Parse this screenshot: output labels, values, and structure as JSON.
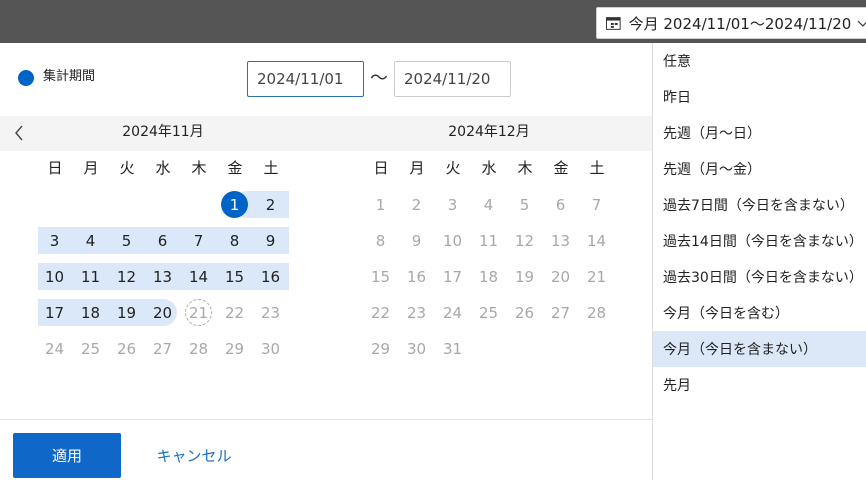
{
  "header": {
    "range_label": "今月 2024/11/01〜2024/11/20"
  },
  "legend": {
    "label": "集計期間",
    "color": "#0063c6"
  },
  "inputs": {
    "start_value": "2024/11/01",
    "end_value": "2024/11/20",
    "separator": "〜"
  },
  "calendar": {
    "left_title": "2024年11月",
    "right_title": "2024年12月",
    "weekdays": [
      "日",
      "月",
      "火",
      "水",
      "木",
      "金",
      "土"
    ],
    "nov_rows": [
      [
        "",
        "",
        "",
        "",
        "",
        "1",
        "2"
      ],
      [
        "3",
        "4",
        "5",
        "6",
        "7",
        "8",
        "9"
      ],
      [
        "10",
        "11",
        "12",
        "13",
        "14",
        "15",
        "16"
      ],
      [
        "17",
        "18",
        "19",
        "20",
        "21",
        "22",
        "23"
      ],
      [
        "24",
        "25",
        "26",
        "27",
        "28",
        "29",
        "30"
      ]
    ],
    "dec_rows": [
      [
        "1",
        "2",
        "3",
        "4",
        "5",
        "6",
        "7"
      ],
      [
        "8",
        "9",
        "10",
        "11",
        "12",
        "13",
        "14"
      ],
      [
        "15",
        "16",
        "17",
        "18",
        "19",
        "20",
        "21"
      ],
      [
        "22",
        "23",
        "24",
        "25",
        "26",
        "27",
        "28"
      ],
      [
        "29",
        "30",
        "31",
        "",
        "",
        "",
        ""
      ]
    ],
    "selected_range": {
      "start": 1,
      "end": 20
    },
    "today": 21
  },
  "footer": {
    "apply_label": "適用",
    "cancel_label": "キャンセル"
  },
  "presets": [
    {
      "label": "任意",
      "active": false
    },
    {
      "label": "昨日",
      "active": false
    },
    {
      "label": "先週（月〜日）",
      "active": false
    },
    {
      "label": "先週（月〜金）",
      "active": false
    },
    {
      "label": "過去7日間（今日を含まない）",
      "active": false
    },
    {
      "label": "過去14日間（今日を含まない）",
      "active": false
    },
    {
      "label": "過去30日間（今日を含まない）",
      "active": false
    },
    {
      "label": "今月（今日を含む）",
      "active": false
    },
    {
      "label": "今月（今日を含まない）",
      "active": true
    },
    {
      "label": "先月",
      "active": false
    }
  ],
  "colors": {
    "accent": "#0063c6",
    "range": "#dbe8fa",
    "topbar": "#555555"
  },
  "icons": {
    "trigger_icon": "calendar-icon",
    "trigger_chevron": "chevron-down-icon",
    "prev": "chevron-left-icon"
  }
}
